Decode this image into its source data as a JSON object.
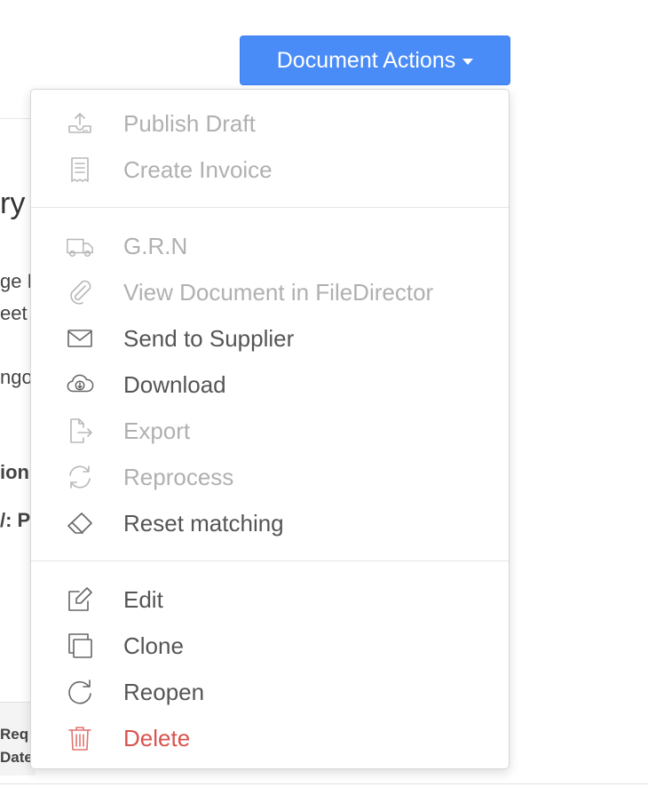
{
  "background": {
    "title_fragment": "ry A",
    "lines": [
      "ge H",
      "eet",
      "ngo"
    ],
    "bold_lines": [
      "ion",
      "/: P"
    ],
    "footer_lines": [
      "Req",
      "Date"
    ]
  },
  "actions_button": {
    "label": "Document Actions"
  },
  "menu": {
    "items": [
      {
        "label": "Publish Draft",
        "icon": "upload-tray-icon",
        "state": "disabled"
      },
      {
        "label": "Create Invoice",
        "icon": "receipt-icon",
        "state": "disabled"
      },
      {
        "label": "G.R.N",
        "icon": "truck-icon",
        "state": "disabled"
      },
      {
        "label": "View Document in FileDirector",
        "icon": "paperclip-icon",
        "state": "disabled"
      },
      {
        "label": "Send to Supplier",
        "icon": "envelope-icon",
        "state": "enabled"
      },
      {
        "label": "Download",
        "icon": "cloud-download-icon",
        "state": "enabled"
      },
      {
        "label": "Export",
        "icon": "file-export-icon",
        "state": "disabled"
      },
      {
        "label": "Reprocess",
        "icon": "refresh-icon",
        "state": "disabled"
      },
      {
        "label": "Reset matching",
        "icon": "eraser-icon",
        "state": "enabled"
      },
      {
        "label": "Edit",
        "icon": "edit-icon",
        "state": "enabled"
      },
      {
        "label": "Clone",
        "icon": "clone-icon",
        "state": "enabled"
      },
      {
        "label": "Reopen",
        "icon": "reopen-icon",
        "state": "enabled"
      },
      {
        "label": "Delete",
        "icon": "trash-icon",
        "state": "danger"
      }
    ]
  },
  "colors": {
    "accent": "#4a8cf7",
    "disabled_text": "#b0b0b0",
    "enabled_text": "#555555",
    "danger": "#d9534f"
  }
}
